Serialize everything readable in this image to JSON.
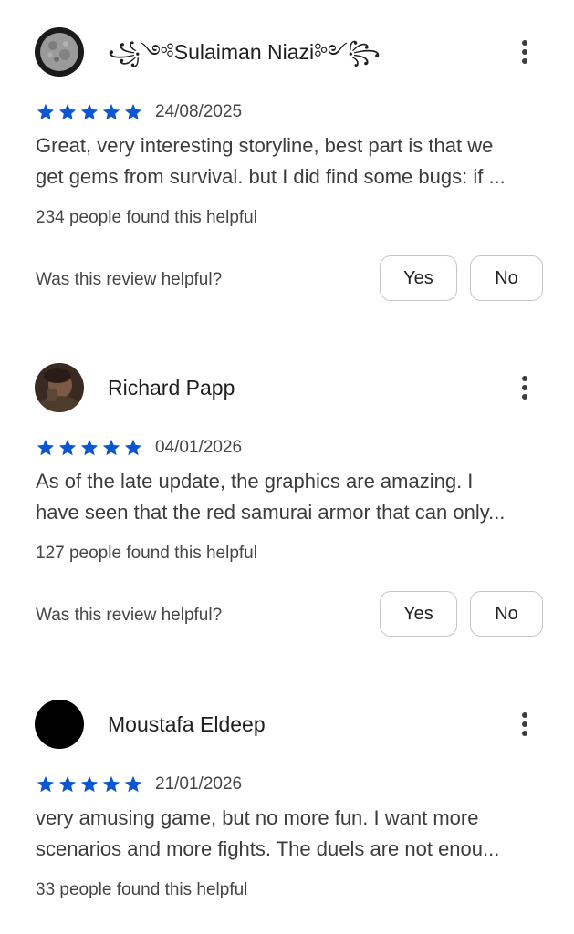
{
  "colors": {
    "star": "#0b57d0",
    "text_primary": "#1f1f1f",
    "text_secondary": "#444746",
    "button_border": "#c4c7c5"
  },
  "icons": {
    "star": "star-icon",
    "more": "more-vert-icon"
  },
  "helpful_prompt": "Was this review helpful?",
  "yes_label": "Yes",
  "no_label": "No",
  "reviews": [
    {
      "name": "꧁༺Sulaiman Niazi༻꧂",
      "rating": 5,
      "date": "24/08/2025",
      "text_line1": "Great, very interesting storyline, best part is that we",
      "text_line2": "get gems from survival. but I did find some bugs: if ...",
      "helpful_count": "234 people found this helpful"
    },
    {
      "name": "Richard Papp",
      "rating": 5,
      "date": "04/01/2026",
      "text_line1": "As of the late update, the graphics are amazing. I",
      "text_line2": "have seen that the red samurai armor that can only...",
      "helpful_count": "127 people found this helpful"
    },
    {
      "name": "Moustafa Eldeep",
      "rating": 5,
      "date": "21/01/2026",
      "text_line1": "very amusing game, but no more fun. I want more",
      "text_line2": "scenarios and more fights. The duels are not enou...",
      "helpful_count": "33 people found this helpful"
    }
  ]
}
